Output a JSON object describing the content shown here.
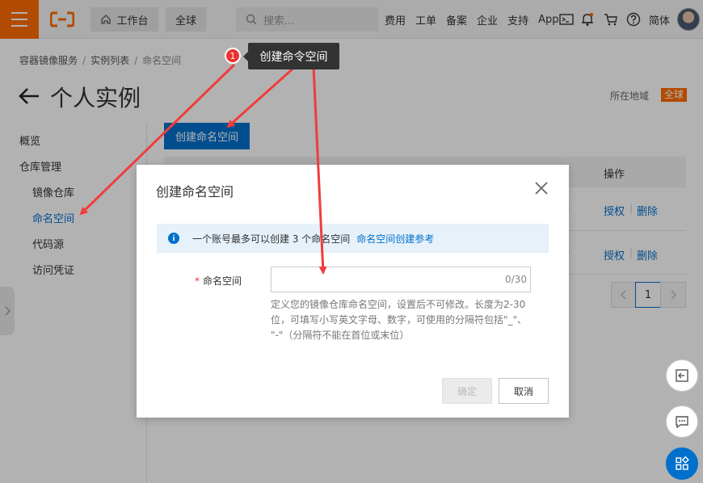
{
  "topbar": {
    "menu_icon": "hamburger-icon",
    "workbench_label": "工作台",
    "region_tab": "全球",
    "search_placeholder": "搜索...",
    "links": [
      "费用",
      "工单",
      "备案",
      "企业",
      "支持",
      "App"
    ],
    "language": "简体"
  },
  "breadcrumb": [
    "容器镜像服务",
    "实例列表",
    "命名空间"
  ],
  "page": {
    "title": "个人实例",
    "region_label": "所在地域",
    "region_value": "全球"
  },
  "sidebar": {
    "items": [
      {
        "label": "概览"
      },
      {
        "label": "仓库管理"
      },
      {
        "label": "镜像仓库"
      },
      {
        "label": "命名空间",
        "active": true
      },
      {
        "label": "代码源"
      },
      {
        "label": "访问凭证"
      }
    ]
  },
  "main": {
    "create_button": "创建命名空间",
    "ops_header": "操作",
    "rows": [
      {
        "frag": "e",
        "action1": "授权",
        "action2": "删除"
      },
      {
        "frag": "e",
        "action1": "授权",
        "action2": "删除"
      }
    ],
    "pager": {
      "current": "1"
    }
  },
  "dialog": {
    "title": "创建命名空间",
    "info_text": "一个账号最多可以创建 3 个命名空间",
    "info_link": "命名空间创建参考",
    "field_label": "命名空间",
    "required_mark": "*",
    "input_value": "",
    "counter": "0/30",
    "help_line1": "定义您的镜像仓库命名空间，设置后不可修改。长度为2-30",
    "help_line2": "位，可填写小写英文字母、数字，可使用的分隔符包括\"_\"、",
    "help_line3": "\"-\"（分隔符不能在首位或末位）",
    "confirm": "确定",
    "cancel": "取消"
  },
  "annotation": {
    "step": "1",
    "tooltip": "创建命令空间",
    "arrow_color": "#f03c3c"
  },
  "colors": {
    "brand": "#ff6a00",
    "primary": "#0070cc"
  }
}
